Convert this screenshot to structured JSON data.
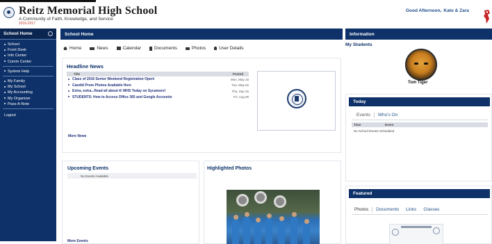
{
  "header": {
    "school_name": "Reitz Memorial High School",
    "tagline": "A Community of Faith, Knowledge, and Service",
    "year": "2016-2017",
    "greeting": "Good Afternoon,",
    "user_name": "Kato & Zara"
  },
  "sidebar": {
    "title": "School Home",
    "groups": [
      [
        "School",
        "Front Desk",
        "Info Center",
        "Comm Center"
      ],
      [
        "System Help"
      ],
      [
        "My Family",
        "My School",
        "My Accounting",
        "My Organizer",
        "Pass-A-Note"
      ]
    ],
    "logout": "Logout"
  },
  "main": {
    "title": "School Home",
    "tabs": [
      "Home",
      "News",
      "Calendar",
      "Documents",
      "Photos",
      "User Details"
    ]
  },
  "headline": {
    "title": "Headline News",
    "col_title": "Title",
    "col_posted": "Posted",
    "items": [
      {
        "title": "Class of 2018 Senior Weekend Registration Open!",
        "posted": "Mon, May 15"
      },
      {
        "title": "Candid Prom Photos Available Here",
        "posted": "Tue, May 02"
      },
      {
        "title": "Extra, extra...Read all about it! MHS Today on Sycamore!",
        "posted": "Thu, Sep 15"
      },
      {
        "title": "STUDENTS: How to Access Office 365 and Google Accounts",
        "posted": "Fri, Aug 05"
      }
    ],
    "more": "More News"
  },
  "events": {
    "title": "Upcoming Events",
    "empty": "No Events Available",
    "more": "More Events"
  },
  "photos": {
    "title": "Highlighted Photos"
  },
  "info": {
    "title": "Information",
    "students_label": "My Students",
    "student_name": "Tom Tiger"
  },
  "today": {
    "title": "Today",
    "tabs": [
      "Events",
      "Who's On"
    ],
    "col_time": "Time",
    "col_event": "Event",
    "empty": "No School Events Scheduled"
  },
  "featured": {
    "title": "Featured",
    "tabs": [
      "Photos",
      "Documents",
      "Links",
      "Classes"
    ]
  },
  "colors": {
    "navy": "#0d3168",
    "link": "#1f2f7a",
    "year_red": "#c0392b"
  }
}
